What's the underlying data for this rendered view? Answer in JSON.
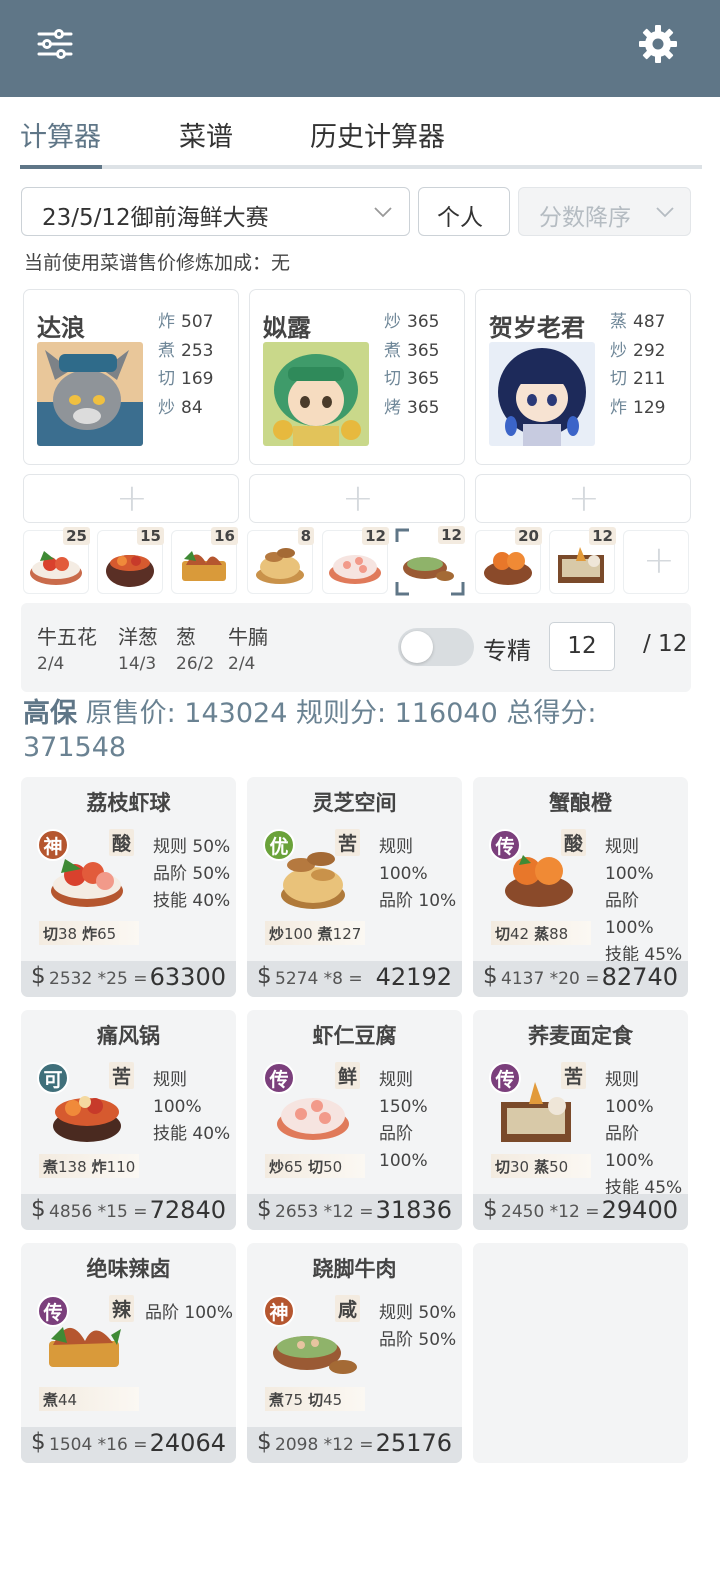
{
  "header": {
    "menu_icon": "sliders-icon",
    "settings_icon": "gear-icon",
    "color": "#5f7687"
  },
  "tabs": [
    {
      "label": "计算器",
      "active": true
    },
    {
      "label": "菜谱",
      "active": false
    },
    {
      "label": "历史计算器",
      "active": false
    }
  ],
  "controls": {
    "contest": "23/5/12御前海鲜大赛",
    "mode": "个人",
    "sort": "分数降序"
  },
  "info_text": "当前使用菜谱售价修炼加成：无",
  "chefs": [
    {
      "name": "达浪",
      "skills": [
        {
          "k": "炸",
          "v": "507"
        },
        {
          "k": "煮",
          "v": "253"
        },
        {
          "k": "切",
          "v": "169"
        },
        {
          "k": "炒",
          "v": "84"
        }
      ]
    },
    {
      "name": "姒露",
      "skills": [
        {
          "k": "炒",
          "v": "365"
        },
        {
          "k": "煮",
          "v": "365"
        },
        {
          "k": "切",
          "v": "365"
        },
        {
          "k": "烤",
          "v": "365"
        }
      ]
    },
    {
      "name": "贺岁老君",
      "skills": [
        {
          "k": "蒸",
          "v": "487"
        },
        {
          "k": "炒",
          "v": "292"
        },
        {
          "k": "切",
          "v": "211"
        },
        {
          "k": "炸",
          "v": "129"
        }
      ]
    }
  ],
  "dish_counts": [
    "25",
    "15",
    "16",
    "8",
    "12",
    "12",
    "20",
    "12"
  ],
  "ingredients": [
    {
      "name": "牛五花",
      "qty": "2/4"
    },
    {
      "name": "洋葱",
      "qty": "14/3"
    },
    {
      "name": "葱",
      "qty": "26/2"
    },
    {
      "name": "牛腩",
      "qty": "2/4"
    }
  ],
  "specialty": {
    "label": "专精",
    "value": "12",
    "total": "/ 12",
    "on": false
  },
  "summary": {
    "name": "高保",
    "orig_label": "原售价:",
    "orig_value": "143024",
    "rule_label": "规则分:",
    "rule_value": "116040",
    "total_label": "总得分:",
    "total_value": "371548"
  },
  "recipes": [
    {
      "title": "荔枝虾球",
      "grade": "神",
      "grade_color": "#b5562f",
      "taste": "酸",
      "rules": [
        "规则 50%",
        "品阶 50%",
        "技能 40%"
      ],
      "req": [
        {
          "k": "切",
          "v": "38"
        },
        {
          "k": "炸",
          "v": "65"
        }
      ],
      "calc": "2532 *25 =",
      "result": "63300"
    },
    {
      "title": "灵芝空间",
      "grade": "优",
      "grade_color": "#6aa23a",
      "taste": "苦",
      "rules": [
        "规则 100%",
        "品阶 10%"
      ],
      "req": [
        {
          "k": "炒",
          "v": "100"
        },
        {
          "k": "煮",
          "v": "127"
        }
      ],
      "calc": "5274 *8 =",
      "result": "42192"
    },
    {
      "title": "蟹酿橙",
      "grade": "传",
      "grade_color": "#7b3f7c",
      "taste": "酸",
      "rules": [
        "规则 100%",
        "品阶 100%",
        "技能 45%"
      ],
      "req": [
        {
          "k": "切",
          "v": "42"
        },
        {
          "k": "蒸",
          "v": "88"
        }
      ],
      "calc": "4137 *20 =",
      "result": "82740"
    },
    {
      "title": "痛风锅",
      "grade": "可",
      "grade_color": "#3f6f7a",
      "taste": "苦",
      "rules": [
        "规则 100%",
        "技能 40%"
      ],
      "req": [
        {
          "k": "煮",
          "v": "138"
        },
        {
          "k": "炸",
          "v": "110"
        }
      ],
      "calc": "4856 *15 =",
      "result": "72840"
    },
    {
      "title": "虾仁豆腐",
      "grade": "传",
      "grade_color": "#7b3f7c",
      "taste": "鲜",
      "rules": [
        "规则 150%",
        "品阶 100%"
      ],
      "req": [
        {
          "k": "炒",
          "v": "65"
        },
        {
          "k": "切",
          "v": "50"
        }
      ],
      "calc": "2653 *12 =",
      "result": "31836"
    },
    {
      "title": "荞麦面定食",
      "grade": "传",
      "grade_color": "#7b3f7c",
      "taste": "苦",
      "rules": [
        "规则 100%",
        "品阶 100%",
        "技能 45%"
      ],
      "req": [
        {
          "k": "切",
          "v": "30"
        },
        {
          "k": "蒸",
          "v": "50"
        }
      ],
      "calc": "2450 *12 =",
      "result": "29400"
    },
    {
      "title": "绝味辣卤",
      "grade": "传",
      "grade_color": "#7b3f7c",
      "taste": "辣",
      "rules": [
        "品阶 100%"
      ],
      "req": [
        {
          "k": "煮",
          "v": "44"
        }
      ],
      "calc": "1504 *16 =",
      "result": "24064"
    },
    {
      "title": "跷脚牛肉",
      "grade": "神",
      "grade_color": "#b5562f",
      "taste": "咸",
      "rules": [
        "规则 50%",
        "品阶 50%"
      ],
      "req": [
        {
          "k": "煮",
          "v": "75"
        },
        {
          "k": "切",
          "v": "45"
        }
      ],
      "calc": "2098 *12 =",
      "result": "25176"
    }
  ]
}
